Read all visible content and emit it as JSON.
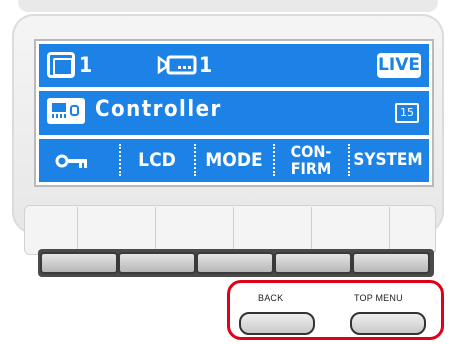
{
  "colors": {
    "lcd_background": "#1c82e6",
    "lcd_foreground": "#ffffff",
    "highlight": "#e0001a"
  },
  "status_bar": {
    "monitor_icon": "monitor-icon",
    "monitor_number": "1",
    "camera_icon": "camera-icon",
    "camera_number": "1",
    "live_label": "LIVE"
  },
  "info_bar": {
    "device_icon": "controller-icon",
    "device_name": "Controller",
    "count_badge": "15"
  },
  "softkeys": [
    {
      "icon": "key-icon",
      "label": ""
    },
    {
      "label": "LCD"
    },
    {
      "label": "MODE"
    },
    {
      "label_line1": "CON-",
      "label_line2": "FIRM"
    },
    {
      "label": "SYSTEM"
    }
  ],
  "hardware_buttons": {
    "back_label": "BACK",
    "top_menu_label": "TOP MENU"
  }
}
